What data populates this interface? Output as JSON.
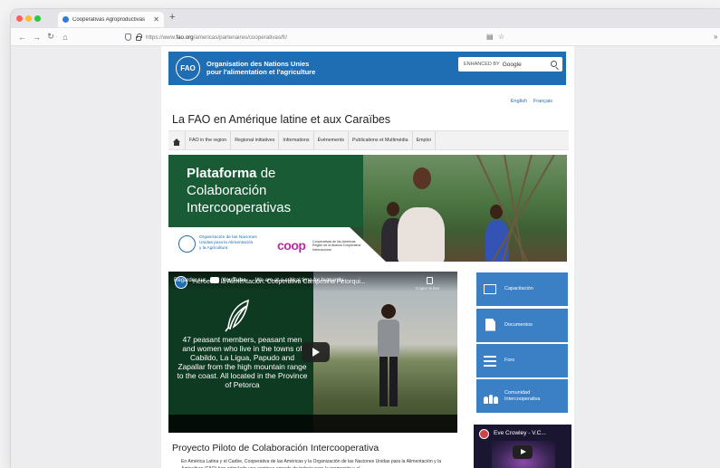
{
  "browser": {
    "tab_title": "Cooperativas Agroproductivas",
    "url_prefix": "https://www.",
    "url_domain": "fao.org",
    "url_path": "/americas/partenaires/cooperativas/fr/"
  },
  "header": {
    "org_line1": "Organisation des Nations Unies",
    "org_line2": "pour l'alimentation et l'agriculture",
    "logo_text": "FAO",
    "search_prefix": "ENHANCED BY",
    "search_brand": "Google"
  },
  "languages": [
    "English",
    "Français"
  ],
  "site_title": "La FAO en Amérique latine et aux Caraïbes",
  "nav": {
    "items": [
      "FAO in the region",
      "Regional initiatives",
      "Informations",
      "Événements",
      "Publications et Multimédia",
      "Emploi"
    ]
  },
  "banner": {
    "title_bold": "Plataforma",
    "title_rest": " de",
    "title_line2": "Colaboración",
    "title_line3": "Intercooperativas",
    "fao_line1": "Organización de las Naciones",
    "fao_line2": "Unidas para la Alimentación",
    "fao_line3": "y la Agricultura",
    "coop_logo": "coop",
    "coop_line1": "Cooperativas de las Américas",
    "coop_line2": "Región de la Alianza Cooperativa",
    "coop_line3": "Internacional"
  },
  "video": {
    "title": "Héroe de la Alimentación: Cooperativa Campesina Petorqui...",
    "copy_label": "Copier le lien",
    "overlay_text": "47 peasant members, peasant men and women who live in the towns of Cabildo, La Ligua, Papudo and Zapallar from the high mountain range to the coast. All located in the Province of Petorca",
    "watch_on": "Regarder sur",
    "youtube": "YouTube",
    "subtitle": "We are at a critical time for humanity"
  },
  "sidebar": {
    "tiles": [
      {
        "label": "Capacitación",
        "icon": "training-board-icon"
      },
      {
        "label": "Documentos",
        "icon": "document-icon"
      },
      {
        "label": "Foro",
        "icon": "forum-icon"
      },
      {
        "label": "Comunidad Intercooperativa",
        "icon": "community-icon"
      }
    ],
    "video_title": "Eve Crowley - V.C..."
  },
  "section": {
    "title": "Proyecto Piloto de Colaboración Intercooperativa",
    "body": "En América Latina y el Caribe, Cooperativa de las Américas y la Organización de las Naciones Unidas para la Alimentación y la Agricultura (FAO) han articulado una continua agenda de trabajo para la promoción y el"
  },
  "colors": {
    "fao_blue": "#1f6db3",
    "tile_blue": "#3b7fc4",
    "banner_green": "#195b35",
    "coop_magenta": "#b72ea0"
  }
}
